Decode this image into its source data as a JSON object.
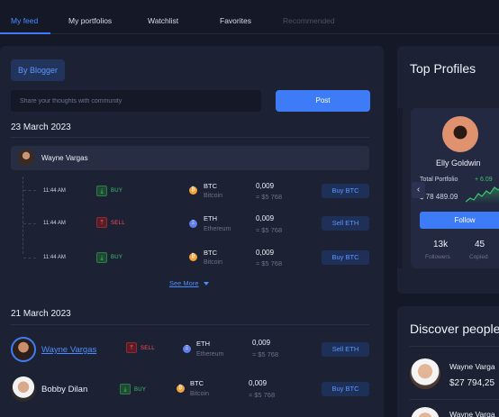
{
  "tabs": [
    "My feed",
    "My portfolios",
    "Watchlist",
    "Favorites",
    "Recommended"
  ],
  "feed": {
    "filter_chip": "By Blogger",
    "share_placeholder": "Share your thoughts with community",
    "post_label": "Post",
    "see_more": "See More",
    "groups": [
      {
        "date": "23 March 2023",
        "author": "Wayne Vargas",
        "transactions": [
          {
            "time": "11:44 AM",
            "action": "BUY",
            "symbol": "BTC",
            "coin": "Bitcoin",
            "amount": "0,009",
            "usd": "≈ $5 768",
            "button": "Buy BTC"
          },
          {
            "time": "11:44 AM",
            "action": "SELL",
            "symbol": "ETH",
            "coin": "Ethereum",
            "amount": "0,009",
            "usd": "≈ $5 768",
            "button": "Sell ETH"
          },
          {
            "time": "11:44 AM",
            "action": "BUY",
            "symbol": "BTC",
            "coin": "Bitcoin",
            "amount": "0,009",
            "usd": "≈ $5 768",
            "button": "Buy BTC"
          }
        ]
      },
      {
        "date": "21 March 2023",
        "entries": [
          {
            "user": "Wayne Vargas",
            "action": "SELL",
            "symbol": "ETH",
            "coin": "Ethereum",
            "amount": "0,009",
            "usd": "≈ $5 768",
            "button": "Sell ETH"
          },
          {
            "user": "Bobby Dilan",
            "action": "BUY",
            "symbol": "BTC",
            "coin": "Bitcoin",
            "amount": "0,009",
            "usd": "≈ $5 768",
            "button": "Buy BTC"
          }
        ]
      }
    ]
  },
  "top_profiles": {
    "title": "Top Profiles",
    "card": {
      "name": "Elly Goldwin",
      "portfolio_label": "Total Portfolio",
      "change": "+ 6.09",
      "value": "$ 78 489.09",
      "follow_label": "Follow",
      "followers_value": "13k",
      "followers_label": "Followers",
      "copied_value": "45",
      "copied_label": "Copied"
    },
    "prev_arrow": "‹"
  },
  "discover": {
    "title": "Discover people",
    "people": [
      {
        "name": "Wayne Varga",
        "value": "$27 794,25"
      },
      {
        "name": "Wayne Varga"
      }
    ]
  },
  "colors": {
    "accent": "#3d7cf6",
    "buy": "#3fc46a",
    "sell": "#ff4f5e",
    "bg": "#141827",
    "panel": "#1c2133"
  },
  "icons": {
    "buy": "download-icon",
    "sell": "upload-icon",
    "btc": "bitcoin-coin-icon",
    "eth": "ethereum-coin-icon"
  }
}
